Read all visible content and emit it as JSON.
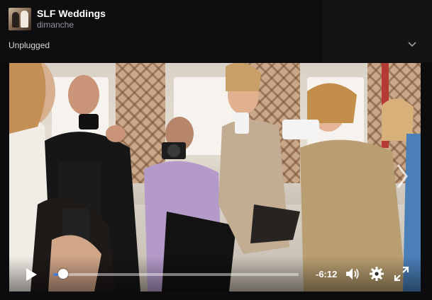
{
  "post": {
    "page_name": "SLF Weddings",
    "date": "dimanche",
    "caption": "Unplugged"
  },
  "player": {
    "time_remaining": "-6:12",
    "progress_fraction": 0.02
  },
  "icons": {
    "avatar": "page-avatar",
    "options": "chevron-down-icon",
    "play": "play-icon",
    "volume": "volume-icon",
    "settings": "gear-icon",
    "fullscreen": "fullscreen-icon",
    "next": "chevron-right-icon"
  },
  "colors": {
    "background": "#0c0c0e",
    "accent": "#4b7bd6",
    "text": "#ffffff"
  }
}
